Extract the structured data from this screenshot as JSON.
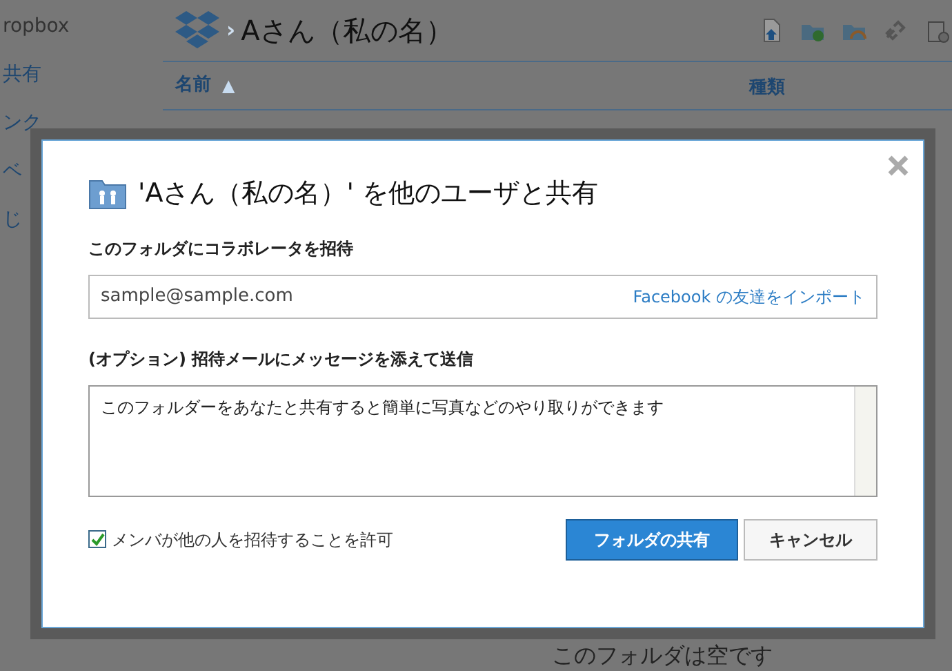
{
  "sidebar": {
    "title": "ropbox",
    "items": [
      "共有",
      "ンク",
      "ベ",
      "じ"
    ]
  },
  "page": {
    "separator": "›",
    "breadcrumb": "Aさん（私の名）",
    "sort_arrow": "▲",
    "columns": [
      {
        "label": "名前",
        "sorted": true
      },
      {
        "label": "種類",
        "sorted": false
      }
    ],
    "empty_message": "このフォルダは空です"
  },
  "dialog": {
    "title": "'Aさん（私の名）' を他のユーザと共有",
    "invite_label": "このフォルダにコラボレータを招待",
    "email": {
      "value": "sample@sample.com"
    },
    "import_link": "Facebook の友達をインポート",
    "message_label": "(オプション) 招待メールにメッセージを添えて送信",
    "message": {
      "value": "このフォルダーをあなたと共有すると簡単に写真などのやり取りができます"
    },
    "allow_invite": {
      "label": "メンバが他の人を招待することを許可",
      "checked": true
    },
    "buttons": [
      {
        "label": "フォルダの共有",
        "kind": "primary"
      },
      {
        "label": "キャンセル",
        "kind": "secondary"
      }
    ]
  }
}
